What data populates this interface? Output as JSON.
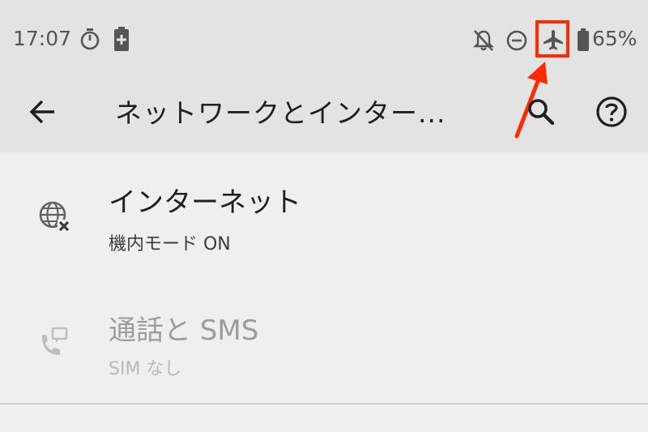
{
  "status_bar": {
    "time": "17:07",
    "battery_percent": "65%",
    "icons": [
      "stopwatch-icon",
      "battery-charging-icon",
      "notifications-off-icon",
      "do-not-disturb-icon",
      "airplane-mode-icon",
      "battery-icon"
    ]
  },
  "app_bar": {
    "title": "ネットワークとインター...",
    "icons": [
      "back-arrow-icon",
      "search-icon",
      "help-icon"
    ]
  },
  "settings": [
    {
      "title": "インターネット",
      "subtitle": "機内モード ON",
      "icon": "globe-offline-icon",
      "enabled": true
    },
    {
      "title": "通話と SMS",
      "subtitle": "SIM なし",
      "icon": "phone-sms-icon",
      "enabled": false
    }
  ],
  "annotation": {
    "color": "#ff2a00",
    "target": "airplane-mode-icon"
  }
}
